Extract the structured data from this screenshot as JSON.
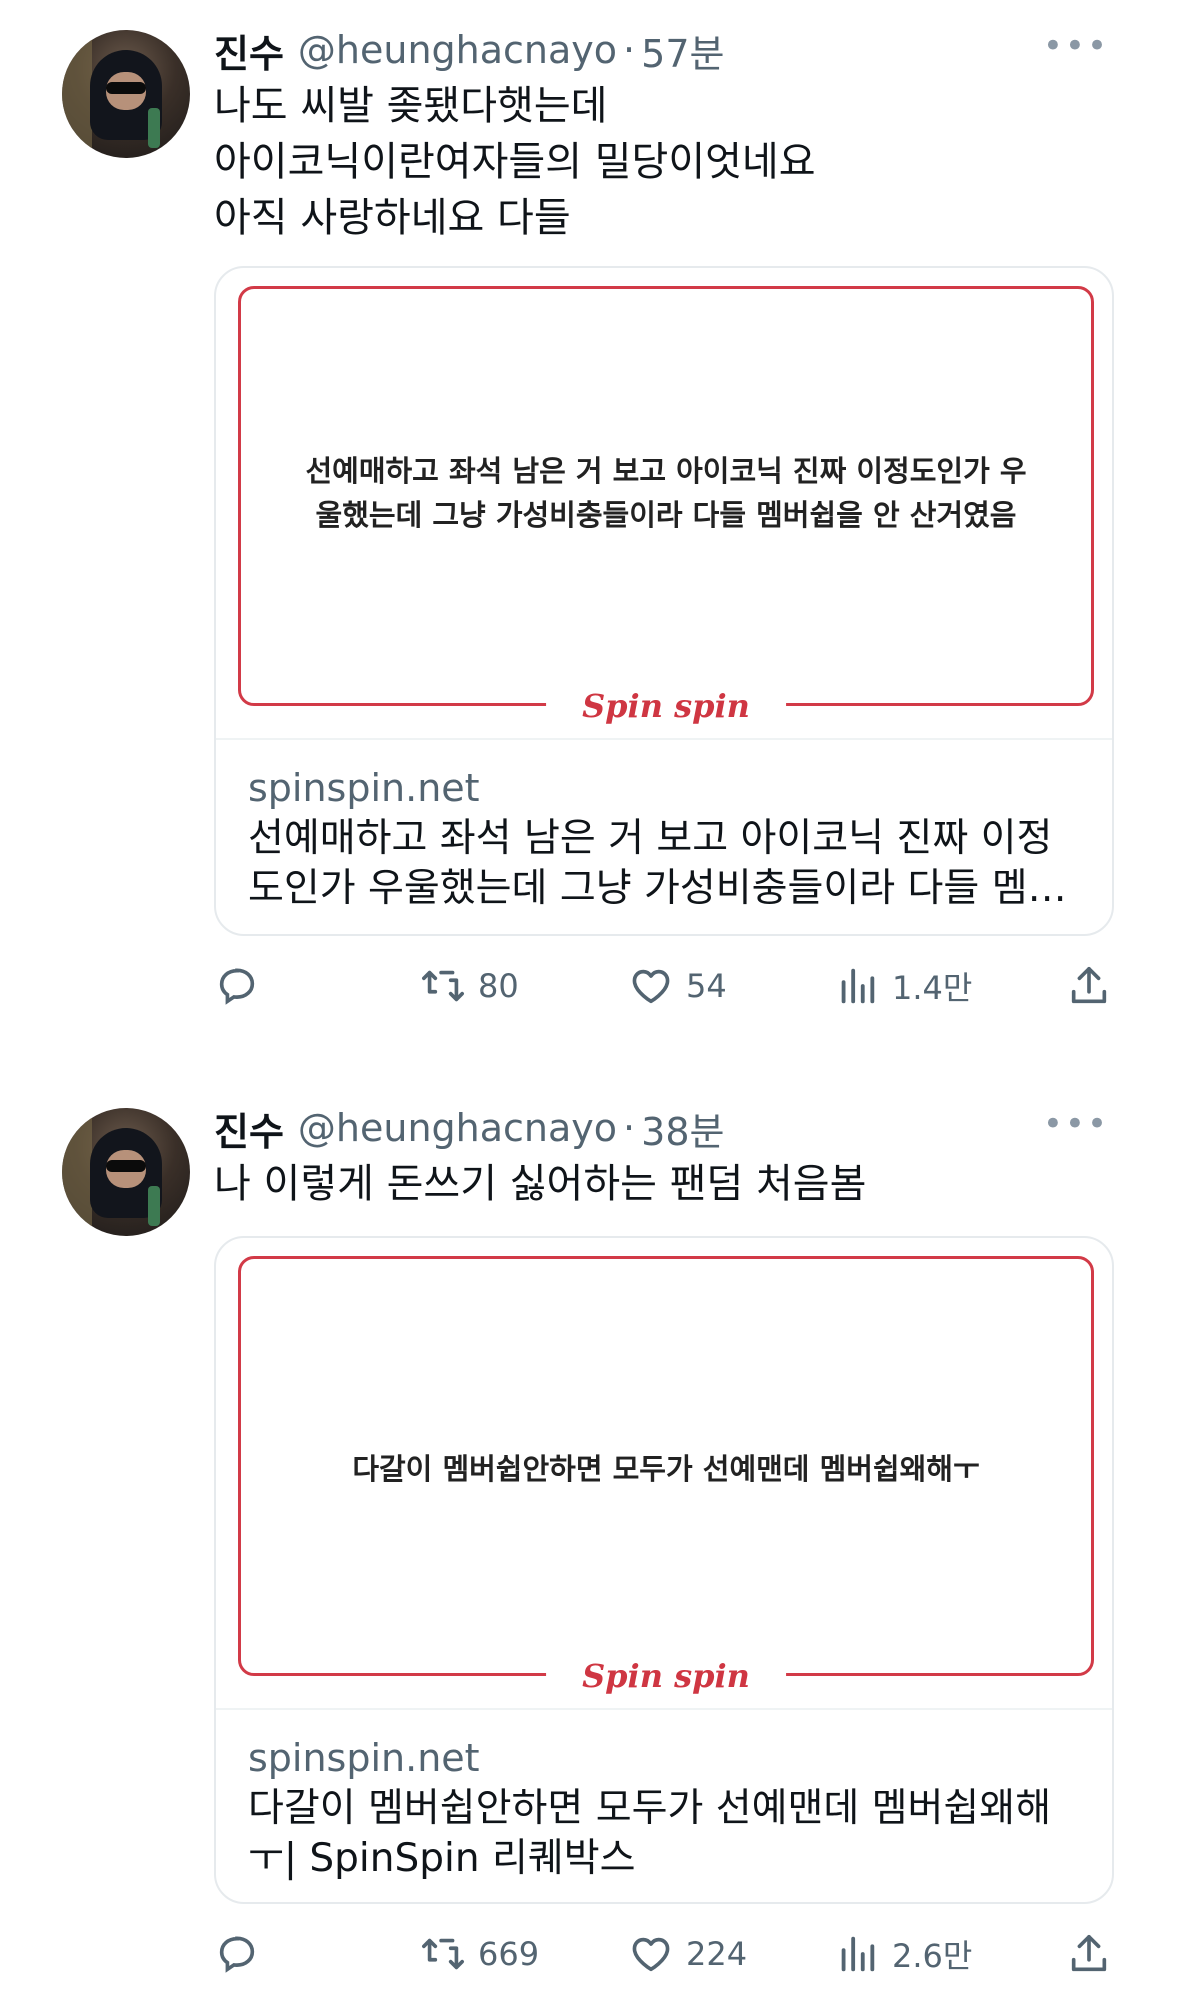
{
  "tweets": [
    {
      "name": "진수",
      "handle": "@heunghacnayo",
      "separator": "·",
      "time": "57분",
      "more": "•••",
      "lines": [
        "나도 씨발 좆됐다햇는데",
        "아이코닉이란여자들의 밀당이엇네요",
        "아직 사랑하네요 다들"
      ],
      "card": {
        "image_lines": [
          "선예매하고 좌석 남은 거 보고 아이코닉 진짜 이정도인가 우",
          "울했는데 그냥 가성비충들이라 다들 멤버쉽을 안 산거였음"
        ],
        "logo": "Spin spin",
        "domain": "spinspin.net",
        "title_lines": [
          "선예매하고 좌석 남은 거 보고 아이코닉 진짜 이정",
          "도인가 우울했는데 그냥 가성비충들이라 다들 멤…"
        ]
      },
      "stats": {
        "retweets": "80",
        "likes": "54",
        "views": "1.4만"
      }
    },
    {
      "name": "진수",
      "handle": "@heunghacnayo",
      "separator": "·",
      "time": "38분",
      "more": "•••",
      "lines": [
        "나 이렇게 돈쓰기 싫어하는 팬덤 처음봄"
      ],
      "card": {
        "image_lines": [
          "다갈이 멤버쉽안하면 모두가 선예맨데 멤버쉽왜해ㅜ"
        ],
        "logo": "Spin spin",
        "domain": "spinspin.net",
        "title_lines": [
          "다갈이 멤버쉽안하면 모두가 선예맨데 멤버쉽왜해",
          "ㅜ| SpinSpin 리퀘박스"
        ]
      },
      "stats": {
        "retweets": "669",
        "likes": "224",
        "views": "2.6만"
      }
    }
  ],
  "icons": [
    "reply-icon",
    "retweet-icon",
    "like-icon",
    "views-icon",
    "share-icon"
  ],
  "colors": {
    "text": "#0f1419",
    "secondary": "#536471",
    "frame": "#d23a47",
    "logo": "#cf3642"
  }
}
